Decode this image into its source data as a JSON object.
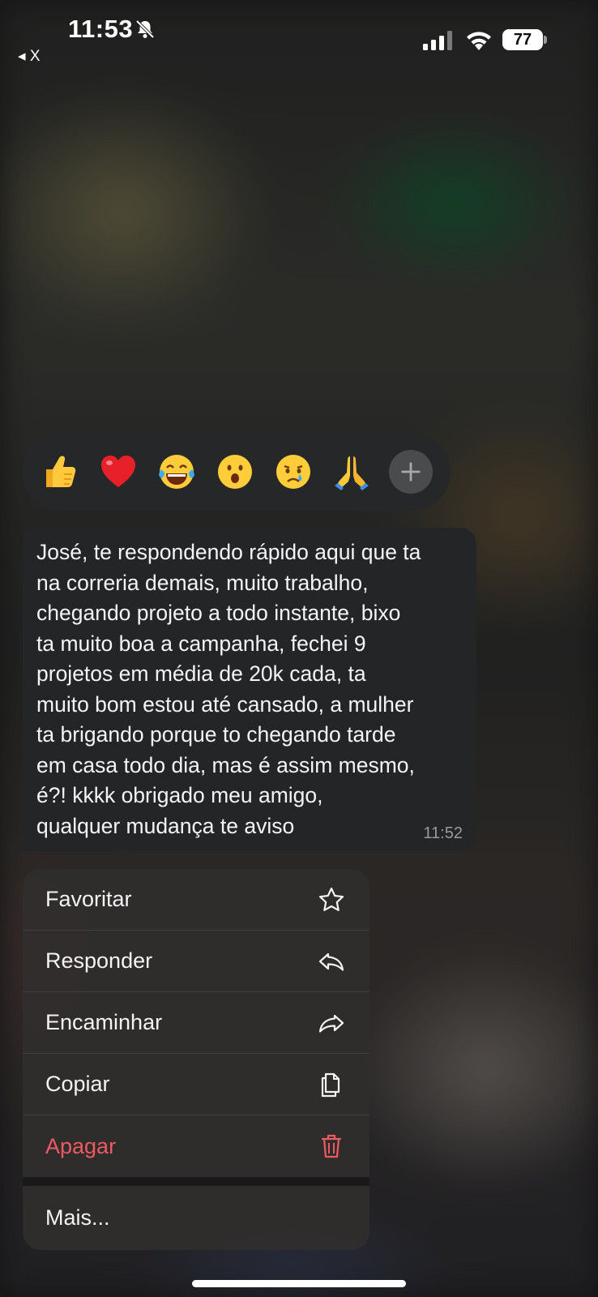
{
  "status_bar": {
    "time": "11:53",
    "battery": "77",
    "back_label": "◂ X"
  },
  "reactions": [
    {
      "name": "thumbs-up-emoji"
    },
    {
      "name": "red-heart-emoji"
    },
    {
      "name": "tears-of-joy-emoji"
    },
    {
      "name": "surprised-emoji"
    },
    {
      "name": "crying-emoji"
    },
    {
      "name": "praying-hands-emoji"
    },
    {
      "name": "add-reaction-icon"
    }
  ],
  "message": {
    "text": "José, te respondendo rápido aqui que ta\nna correria demais, muito trabalho,\nchegando projeto a todo instante, bixo\nta muito boa a campanha, fechei 9\nprojetos em média de 20k cada, ta\nmuito bom estou até cansado, a mulher\nta brigando porque to chegando tarde\nem casa todo dia, mas é assim mesmo,\né?! kkkk obrigado meu amigo,\nqualquer mudança te aviso",
    "time": "11:52"
  },
  "menu": {
    "items": [
      {
        "label": "Favoritar",
        "icon": "star-icon"
      },
      {
        "label": "Responder",
        "icon": "reply-icon"
      },
      {
        "label": "Encaminhar",
        "icon": "forward-icon"
      },
      {
        "label": "Copiar",
        "icon": "copy-icon"
      },
      {
        "label": "Apagar",
        "icon": "trash-icon",
        "color": "#ef5a62"
      }
    ],
    "more_label": "Mais..."
  }
}
